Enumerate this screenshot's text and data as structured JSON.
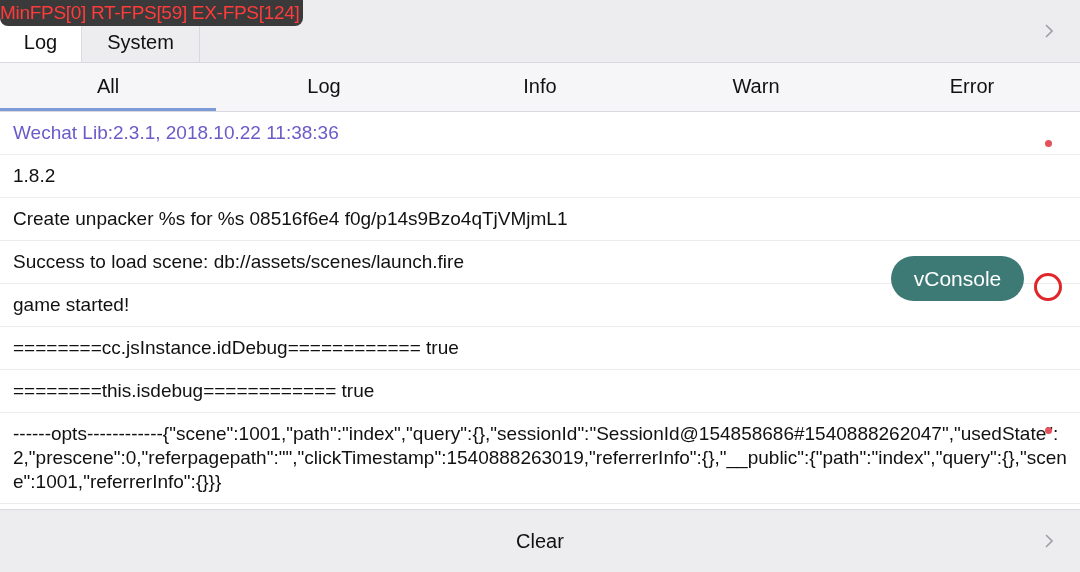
{
  "fps_overlay": "MinFPS[0] RT-FPS[59] EX-FPS[124]",
  "tabs": [
    {
      "label": "Log",
      "selected": true
    },
    {
      "label": "System",
      "selected": false
    }
  ],
  "filters": [
    {
      "label": "All",
      "selected": true
    },
    {
      "label": "Log",
      "selected": false
    },
    {
      "label": "Info",
      "selected": false
    },
    {
      "label": "Warn",
      "selected": false
    },
    {
      "label": "Error",
      "selected": false
    }
  ],
  "logs": [
    {
      "kind": "info",
      "text": "Wechat Lib:2.3.1, 2018.10.22 11:38:36"
    },
    {
      "kind": "log",
      "text": "1.8.2"
    },
    {
      "kind": "log",
      "text": "Create unpacker %s for %s 08516f6e4 f0g/p14s9Bzo4qTjVMjmL1"
    },
    {
      "kind": "log",
      "text": "Success to load scene: db://assets/scenes/launch.fire"
    },
    {
      "kind": "log",
      "text": "game started!"
    },
    {
      "kind": "log",
      "text": "========cc.jsInstance.idDebug============ true"
    },
    {
      "kind": "log",
      "text": "========this.isdebug============ true"
    },
    {
      "kind": "log",
      "text": "------opts------------{\"scene\":1001,\"path\":\"index\",\"query\":{},\"sessionId\":\"SessionId@154858686#1540888262047\",\"usedState\":2,\"prescene\":0,\"referpagepath\":\"\",\"clickTimestamp\":1540888263019,\"referrerInfo\":{},\"__public\":{\"path\":\"index\",\"query\":{},\"scene\":1001,\"referrerInfo\":{}}}"
    }
  ],
  "floating_button": "vConsole",
  "footer": {
    "button": "Clear"
  }
}
